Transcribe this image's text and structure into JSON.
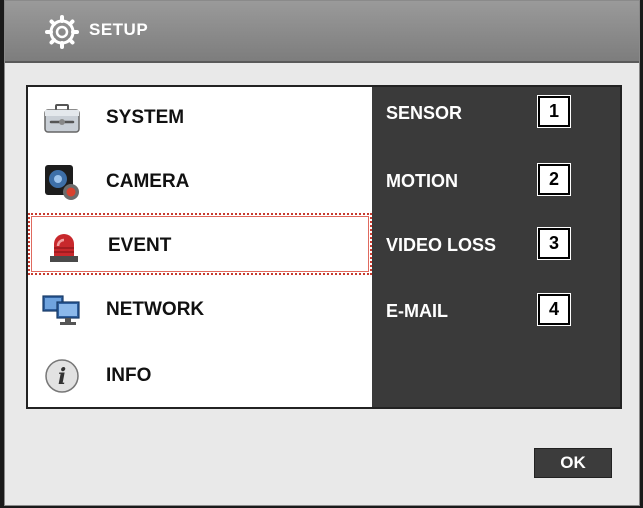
{
  "window": {
    "title": "SETUP",
    "title_icon": "gear-icon"
  },
  "menu": {
    "items": [
      {
        "label": "SYSTEM",
        "icon": "toolbox-icon"
      },
      {
        "label": "CAMERA",
        "icon": "camera-icon"
      },
      {
        "label": "EVENT",
        "icon": "alarm-light-icon",
        "selected": true
      },
      {
        "label": "NETWORK",
        "icon": "network-computers-icon"
      },
      {
        "label": "INFO",
        "icon": "info-icon"
      }
    ]
  },
  "submenu": {
    "items": [
      {
        "label": "SENSOR",
        "number": "1"
      },
      {
        "label": "MOTION",
        "number": "2"
      },
      {
        "label": "VIDEO LOSS",
        "number": "3"
      },
      {
        "label": "E-MAIL",
        "number": "4"
      }
    ]
  },
  "footer": {
    "ok_label": "OK"
  },
  "colors": {
    "titlebar": "#8a8a8a",
    "submenu_bg": "#3a3a3a",
    "selection_border": "#c83a2e",
    "ok_button": "#3c3c3c"
  }
}
